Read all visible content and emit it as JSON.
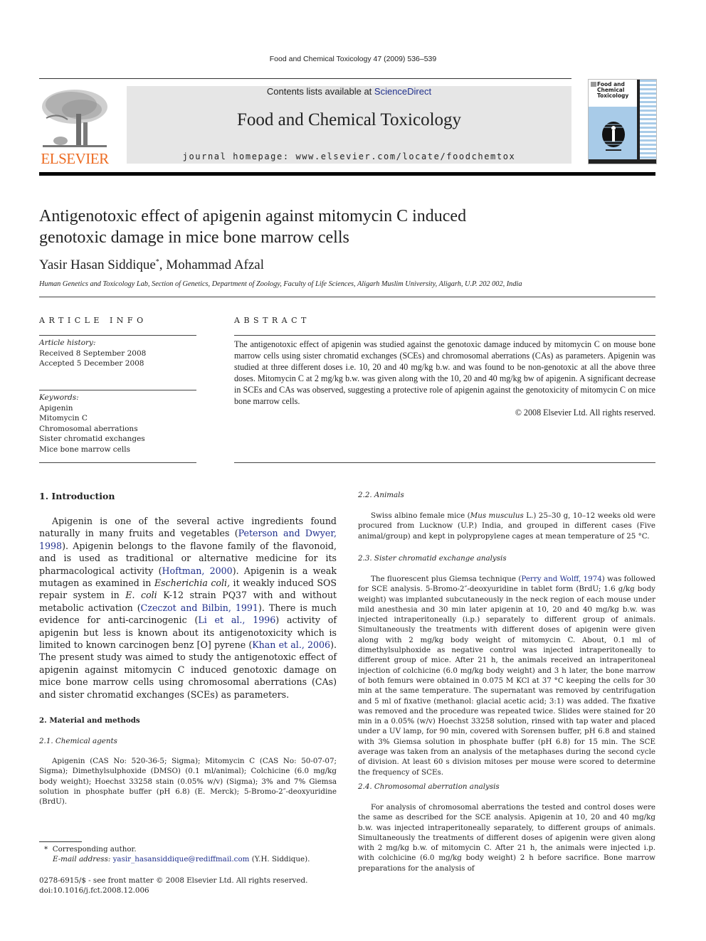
{
  "running_head": "Food and Chemical Toxicology 47 (2009) 536–539",
  "masthead": {
    "publisher_logo_text": "ELSEVIER",
    "contents_prefix": "Contents lists available at ",
    "contents_link": "ScienceDirect",
    "journal_title": "Food and Chemical Toxicology",
    "homepage": "journal homepage: www.elsevier.com/locate/foodchemtox",
    "cover_title": "Food and Chemical Toxicology"
  },
  "article": {
    "title_line1": "Antigenotoxic effect of apigenin against mitomycin C induced",
    "title_line2": "genotoxic damage in mice bone marrow cells",
    "author1": "Yasir Hasan Siddique",
    "author1_mark": "*",
    "author_sep": ", ",
    "author2": "Mohammad Afzal",
    "affiliation": "Human Genetics and Toxicology Lab, Section of Genetics, Department of Zoology, Faculty of Life Sciences, Aligarh Muslim University, Aligarh, U.P. 202 002, India"
  },
  "article_info": {
    "heading": "ARTICLE INFO",
    "history_label": "Article history:",
    "received": "Received 8 September 2008",
    "accepted": "Accepted 5 December 2008",
    "keywords_label": "Keywords:",
    "keywords": [
      "Apigenin",
      "Mitomycin C",
      "Chromosomal aberrations",
      "Sister chromatid exchanges",
      "Mice bone marrow cells"
    ]
  },
  "abstract": {
    "heading": "ABSTRACT",
    "text": "The antigenotoxic effect of apigenin was studied against the genotoxic damage induced by mitomycin C on mouse bone marrow cells using sister chromatid exchanges (SCEs) and chromosomal aberrations (CAs) as parameters. Apigenin was studied at three different doses i.e. 10, 20 and 40 mg/kg b.w. and was found to be non-genotoxic at all the above three doses. Mitomycin C at 2 mg/kg b.w. was given along with the 10, 20 and 40 mg/kg bw of apigenin. A significant decrease in SCEs and CAs was observed, suggesting a protective role of apigenin against the genotoxicity of mitomycin C on mice bone marrow cells.",
    "copyright": "© 2008 Elsevier Ltd. All rights reserved."
  },
  "intro": {
    "heading": "1. Introduction",
    "p1_a": "Apigenin is one of the several active ingredients found naturally in many fruits and vegetables (",
    "ref1": "Peterson and Dwyer, 1998",
    "p1_b": "). Apigenin belongs to the flavone family of the flavonoid, and is used as traditional or alternative medicine for its pharmacological activity (",
    "ref2": "Hoftman, 2000",
    "p1_c": "). Apigenin is a weak mutagen as examined in ",
    "ital1": "Escherichia coli,",
    "p1_d": " it weakly induced SOS repair system in ",
    "ital2": "E. coli",
    "p1_e": " K-12 strain PQ37 with and without metabolic activation (",
    "ref3": "Czeczot and Bilbin, 1991",
    "p1_f": "). There is much evidence for anti-carcinogenic (",
    "ref4": "Li et al., 1996",
    "p1_g": ") activity of apigenin but less is known about its antigenotoxicity which is limited to known carcinogen benz [O] pyrene (",
    "ref5": "Khan et al., 2006",
    "p1_h": "). The present study was aimed to study the antigenotoxic effect of apigenin against mitomycin C induced genotoxic damage on mice bone marrow cells using chromosomal aberrations (CAs) and sister chromatid exchanges (SCEs) as parameters."
  },
  "methods": {
    "heading": "2. Material and methods",
    "chem_heading": "2.1. Chemical agents",
    "chem_text": "Apigenin (CAS No: 520-36-5; Sigma); Mitomycin C (CAS No: 50-07-07; Sigma); Dimethylsulphoxide (DMSO) (0.1 ml/animal); Colchicine (6.0 mg/kg body weight); Hoechst 33258 stain (0.05% w/v) (Sigma); 3% and 7% Giemsa solution in phosphate buffer (pH 6.8) (E. Merck); 5-Bromo-2″-deoxyuridine (BrdU).",
    "animals_heading": "2.2. Animals",
    "animals_a": "Swiss albino female mice (",
    "animals_ital": "Mus musculus",
    "animals_b": " L.) 25–30 g, 10–12 weeks old were procured from Lucknow (U.P.) India, and grouped in different cases (Five animal/group) and kept in polypropylene cages at mean temperature of 25 °C.",
    "sce_heading": "2.3. Sister chromatid exchange analysis",
    "sce_a": "The fluorescent plus Giemsa technique (",
    "sce_ref": "Perry and Wolff, 1974",
    "sce_b": ") was followed for SCE analysis. 5-Bromo-2″-deoxyuridine in tablet form (BrdU; 1.6 g/kg body weight) was implanted subcutaneously in the neck region of each mouse under mild anesthesia and 30 min later apigenin at 10, 20 and 40 mg/kg b.w. was injected intraperitoneally (i.p.) separately to different group of animals. Simultaneously the treatments with different doses of apigenin were given along with 2 mg/kg body weight of mitomycin C. About, 0.1 ml of dimethylsulphoxide as negative control was injected intraperitoneally to different group of mice. After 21 h, the animals received an intraperitoneal injection of colchicine (6.0 mg/kg body weight) and 3 h later, the bone marrow of both femurs were obtained in 0.075 M KCl at 37 °C keeping the cells for 30 min at the same temperature. The supernatant was removed by centrifugation and 5 ml of fixative (methanol: glacial acetic acid; 3:1) was added. The fixative was removed and the procedure was repeated twice. Slides were stained for 20 min in a 0.05% (w/v) Hoechst 33258 solution, rinsed with tap water and placed under a UV lamp, for 90 min, covered with Sorensen buffer, pH 6.8 and stained with 3% Giemsa solution in phosphate buffer (pH 6.8) for 15 min. The SCE average was taken from an analysis of the metaphases during the second cycle of division. At least 60 s division mitoses per mouse were scored to determine the frequency of SCEs.",
    "ca_heading": "2.4. Chromosomal aberration analysis",
    "ca_text": "For analysis of chromosomal aberrations the tested and control doses were the same as described for the SCE analysis. Apigenin at 10, 20 and 40 mg/kg b.w. was injected intraperitoneally separately, to different groups of animals. Simultaneously the treatments of different doses of apigenin were given along with 2 mg/kg b.w. of mitomycin C. After 21 h, the animals were injected i.p. with colchicine (6.0 mg/kg body weight) 2 h before sacrifice. Bone marrow preparations for the analysis of"
  },
  "footnote": {
    "mark": "*",
    "corresponding": "Corresponding author.",
    "email_label": "E-mail address:",
    "email": "yasir_hasansiddique@rediffmail.com",
    "email_suffix": " (Y.H. Siddique)."
  },
  "issn_line": "0278-6915/$ - see front matter © 2008 Elsevier Ltd. All rights reserved.",
  "doi": "doi:10.1016/j.fct.2008.12.006",
  "colors": {
    "link": "#1f2f8c",
    "elsevier_orange": "#ec6b22",
    "masthead_bg": "#e6e6e6",
    "cover_blue": "#a8cbe8"
  }
}
